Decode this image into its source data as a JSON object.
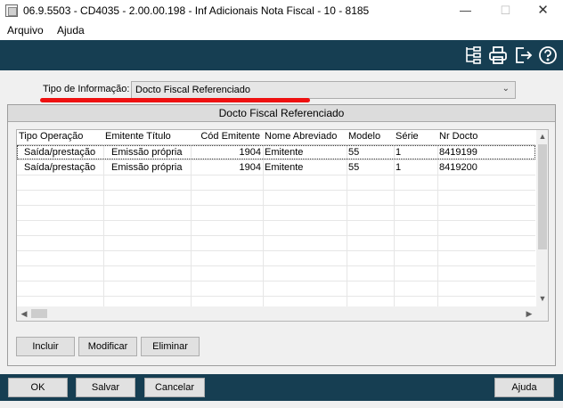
{
  "window": {
    "title": "06.9.5503 - CD4035 - 2.00.00.198 - Inf Adicionais Nota Fiscal - 10 - 8185",
    "minimize": "—",
    "maximize": "☐",
    "close": "✕"
  },
  "menu": {
    "items": [
      "Arquivo",
      "Ajuda"
    ]
  },
  "toolbar": {
    "icons": [
      "tree-structure-icon",
      "print-icon",
      "exit-icon",
      "help-icon"
    ]
  },
  "form": {
    "tipo_label": "Tipo de Informação:",
    "tipo_value": "Docto Fiscal Referenciado"
  },
  "panel": {
    "title": "Docto Fiscal Referenciado"
  },
  "table": {
    "columns": [
      "Tipo Operação",
      "Emitente Título",
      "Cód Emitente",
      "Nome Abreviado",
      "Modelo",
      "Série",
      "Nr Docto"
    ],
    "rows": [
      [
        "Saída/prestação",
        "Emissão própria",
        "1904",
        "Emitente",
        "55",
        "1",
        "8419199"
      ],
      [
        "Saída/prestação",
        "Emissão própria",
        "1904",
        "Emitente",
        "55",
        "1",
        "8419200"
      ]
    ]
  },
  "actions": {
    "incluir": "Incluir",
    "modificar": "Modificar",
    "eliminar": "Eliminar"
  },
  "footer": {
    "ok": "OK",
    "salvar": "Salvar",
    "cancelar": "Cancelar",
    "ajuda": "Ajuda"
  },
  "colors": {
    "toolbar_bg": "#163e52",
    "highlight_mark": "#ee1111"
  }
}
